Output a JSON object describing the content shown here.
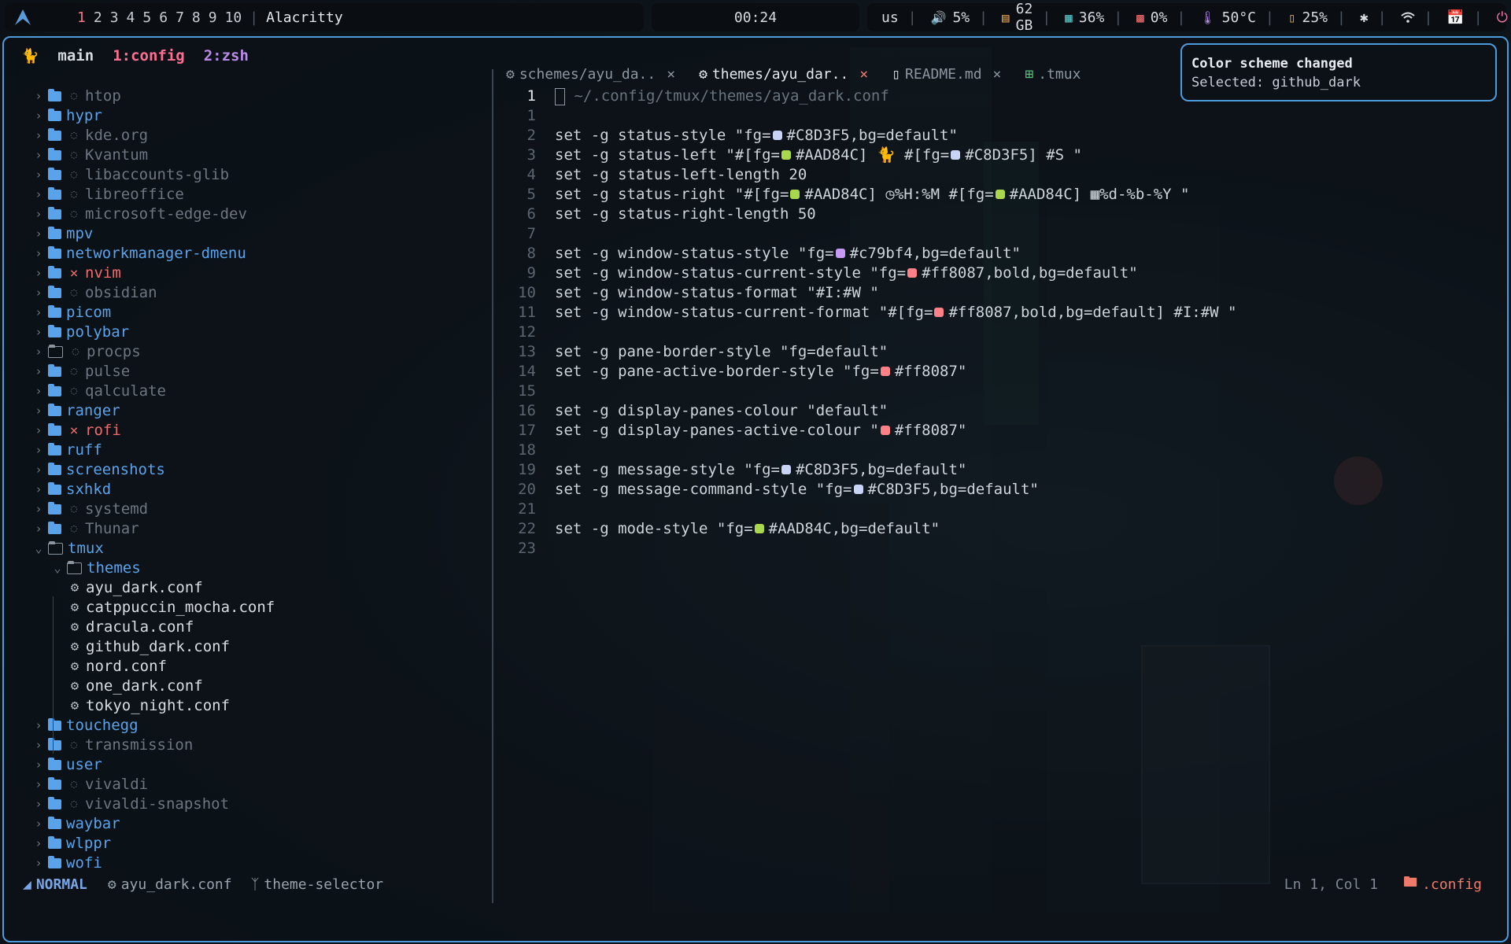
{
  "topbar": {
    "workspaces": [
      "1",
      "2",
      "3",
      "4",
      "5",
      "6",
      "7",
      "8",
      "9",
      "10"
    ],
    "active_workspace": "1",
    "app_title": "Alacritty",
    "clock": "00:24",
    "keyboard": "us",
    "volume": "5%",
    "disk": "62 GB",
    "memory": "36%",
    "cpu": "0%",
    "temp": "50°C",
    "battery": "25%"
  },
  "tmux": {
    "session": "main",
    "current_window": "1:config",
    "other_window": "2:zsh"
  },
  "tree": {
    "items": [
      {
        "name": "htop",
        "style": "dim",
        "status": "ignored"
      },
      {
        "name": "hypr",
        "style": "dir",
        "status": ""
      },
      {
        "name": "kde.org",
        "style": "dim",
        "status": "ignored"
      },
      {
        "name": "Kvantum",
        "style": "dim",
        "status": "ignored"
      },
      {
        "name": "libaccounts-glib",
        "style": "dim",
        "status": "ignored"
      },
      {
        "name": "libreoffice",
        "style": "dim",
        "status": "ignored"
      },
      {
        "name": "microsoft-edge-dev",
        "style": "dim",
        "status": "ignored"
      },
      {
        "name": "mpv",
        "style": "dir",
        "status": ""
      },
      {
        "name": "networkmanager-dmenu",
        "style": "dir",
        "status": ""
      },
      {
        "name": "nvim",
        "style": "err",
        "status": "error"
      },
      {
        "name": "obsidian",
        "style": "dim",
        "status": "ignored"
      },
      {
        "name": "picom",
        "style": "dir",
        "status": ""
      },
      {
        "name": "polybar",
        "style": "dir",
        "status": ""
      },
      {
        "name": "procps",
        "style": "dim",
        "status": "ignored"
      },
      {
        "name": "pulse",
        "style": "dim",
        "status": "ignored"
      },
      {
        "name": "qalculate",
        "style": "dim",
        "status": "ignored"
      },
      {
        "name": "ranger",
        "style": "dir",
        "status": ""
      },
      {
        "name": "rofi",
        "style": "err",
        "status": "error"
      },
      {
        "name": "ruff",
        "style": "dir",
        "status": ""
      },
      {
        "name": "screenshots",
        "style": "dir",
        "status": ""
      },
      {
        "name": "sxhkd",
        "style": "dir",
        "status": ""
      },
      {
        "name": "systemd",
        "style": "dim",
        "status": "ignored"
      },
      {
        "name": "Thunar",
        "style": "dim",
        "status": "ignored"
      }
    ],
    "open_folder": "tmux",
    "sub_folder": "themes",
    "theme_files": [
      "ayu_dark.conf",
      "catppuccin_mocha.conf",
      "dracula.conf",
      "github_dark.conf",
      "nord.conf",
      "one_dark.conf",
      "tokyo_night.conf"
    ],
    "after_items": [
      {
        "name": "touchegg",
        "style": "dir",
        "status": ""
      },
      {
        "name": "transmission",
        "style": "dim",
        "status": "ignored"
      },
      {
        "name": "user",
        "style": "dir",
        "status": ""
      },
      {
        "name": "vivaldi",
        "style": "dim",
        "status": "ignored"
      },
      {
        "name": "vivaldi-snapshot",
        "style": "dim",
        "status": "ignored"
      },
      {
        "name": "waybar",
        "style": "dir",
        "status": ""
      },
      {
        "name": "wlppr",
        "style": "dir",
        "status": ""
      },
      {
        "name": "wofi",
        "style": "dir",
        "status": ""
      }
    ]
  },
  "editor": {
    "tabs": [
      {
        "label": "schemes/ayu_da..",
        "icon": "gear-icon",
        "active": false
      },
      {
        "label": "themes/ayu_dar..",
        "icon": "gear-icon",
        "active": true
      },
      {
        "label": "README.md",
        "icon": "markdown-icon",
        "active": false
      },
      {
        "label": ".tmux",
        "icon": "layout-icon",
        "active": false
      }
    ],
    "lines": [
      {
        "n": "1",
        "segs": [
          {
            "t": "# ~/.config/tmux/themes/aya_dark.conf"
          }
        ],
        "comment": true
      },
      {
        "n": "1",
        "segs": [
          {
            "t": ""
          }
        ]
      },
      {
        "n": "2",
        "segs": [
          {
            "t": "set -g status-style \"fg="
          },
          {
            "sw": "#c8d3f5"
          },
          {
            "t": "#C8D3F5,bg=default\""
          }
        ]
      },
      {
        "n": "3",
        "segs": [
          {
            "t": "set -g status-left \"#[fg="
          },
          {
            "sw": "#aad84c"
          },
          {
            "t": "#AAD84C] "
          },
          {
            "icon": "cat"
          },
          {
            "t": " #[fg="
          },
          {
            "sw": "#c8d3f5"
          },
          {
            "t": "#C8D3F5] #S \""
          }
        ]
      },
      {
        "n": "4",
        "segs": [
          {
            "t": "set -g status-left-length 20"
          }
        ]
      },
      {
        "n": "5",
        "segs": [
          {
            "t": "set -g status-right \"#[fg="
          },
          {
            "sw": "#aad84c"
          },
          {
            "t": "#AAD84C] "
          },
          {
            "icon": "clock"
          },
          {
            "t": "%H:%M #[fg="
          },
          {
            "sw": "#aad84c"
          },
          {
            "t": "#AAD84C] "
          },
          {
            "icon": "calendar"
          },
          {
            "t": "%d-%b-%Y \""
          }
        ]
      },
      {
        "n": "6",
        "segs": [
          {
            "t": "set -g status-right-length 50"
          }
        ]
      },
      {
        "n": "7",
        "segs": [
          {
            "t": ""
          }
        ]
      },
      {
        "n": "8",
        "segs": [
          {
            "t": "set -g window-status-style \"fg="
          },
          {
            "sw": "#c79bf4"
          },
          {
            "t": "#c79bf4,bg=default\""
          }
        ]
      },
      {
        "n": "9",
        "segs": [
          {
            "t": "set -g window-status-current-style \"fg="
          },
          {
            "sw": "#ff8087"
          },
          {
            "t": "#ff8087,bold,bg=default\""
          }
        ]
      },
      {
        "n": "10",
        "segs": [
          {
            "t": "set -g window-status-format \"#I:#W \""
          }
        ]
      },
      {
        "n": "11",
        "segs": [
          {
            "t": "set -g window-status-current-format \"#[fg="
          },
          {
            "sw": "#ff8087"
          },
          {
            "t": "#ff8087,bold,bg=default] #I:#W \""
          }
        ]
      },
      {
        "n": "12",
        "segs": [
          {
            "t": ""
          }
        ]
      },
      {
        "n": "13",
        "segs": [
          {
            "t": "set -g pane-border-style \"fg=default\""
          }
        ]
      },
      {
        "n": "14",
        "segs": [
          {
            "t": "set -g pane-active-border-style \"fg="
          },
          {
            "sw": "#ff8087"
          },
          {
            "t": "#ff8087\""
          }
        ]
      },
      {
        "n": "15",
        "segs": [
          {
            "t": ""
          }
        ]
      },
      {
        "n": "16",
        "segs": [
          {
            "t": "set -g display-panes-colour \"default\""
          }
        ]
      },
      {
        "n": "17",
        "segs": [
          {
            "t": "set -g display-panes-active-colour \""
          },
          {
            "sw": "#ff8087"
          },
          {
            "t": "#ff8087\""
          }
        ]
      },
      {
        "n": "18",
        "segs": [
          {
            "t": ""
          }
        ]
      },
      {
        "n": "19",
        "segs": [
          {
            "t": "set -g message-style \"fg="
          },
          {
            "sw": "#c8d3f5"
          },
          {
            "t": "#C8D3F5,bg=default\""
          }
        ]
      },
      {
        "n": "20",
        "segs": [
          {
            "t": "set -g message-command-style \"fg="
          },
          {
            "sw": "#c8d3f5"
          },
          {
            "t": "#C8D3F5,bg=default\""
          }
        ]
      },
      {
        "n": "21",
        "segs": [
          {
            "t": ""
          }
        ]
      },
      {
        "n": "22",
        "segs": [
          {
            "t": "set -g mode-style \"fg="
          },
          {
            "sw": "#aad84c"
          },
          {
            "t": "#AAD84C,bg=default\""
          }
        ]
      },
      {
        "n": "23",
        "segs": [
          {
            "t": ""
          }
        ]
      }
    ]
  },
  "statusline": {
    "mode": "NORMAL",
    "file": "ayu_dark.conf",
    "branch": "theme-selector",
    "position": "Ln 1, Col 1",
    "dir": ".config"
  },
  "notification": {
    "title": "Color scheme changed",
    "body": "Selected: github_dark"
  },
  "colors": {
    "accent": "#4e9bdc",
    "dir": "#5aa3ea",
    "error": "#ef6c6c"
  }
}
